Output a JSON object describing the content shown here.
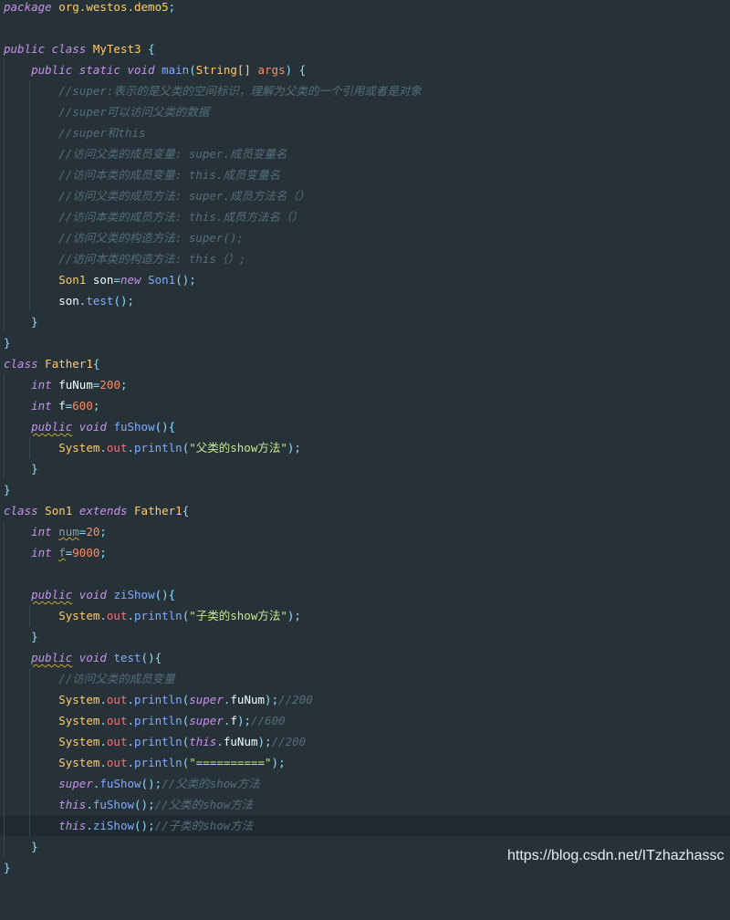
{
  "code": {
    "package_kw": "package",
    "package_name": "org.westos.demo5",
    "class_main": "MyTest3",
    "main_sig": {
      "mods": "public static void",
      "name": "main",
      "type": "String[]",
      "param": "args"
    },
    "comments_main": [
      "//super:表示的是父类的空间标识，理解为父类的一个引用或者是对象",
      "//super可以访问父类的数据",
      "//super和this",
      "//访问父类的成员变量: super.成员变量名",
      "//访问本类的成员变量: this.成员变量名",
      "//访问父类的成员方法: super.成员方法名（）",
      "//访问本类的成员方法: this.成员方法名（）",
      "//访问父类的构造方法: super();",
      "//访问本类的构造方法: this（）;"
    ],
    "class_father": "Father1",
    "father_fields": [
      {
        "name": "fuNum",
        "value": "200"
      },
      {
        "name": "f",
        "value": "600"
      }
    ],
    "father_method": "fuShow",
    "father_str": "\"父类的show方法\"",
    "class_son": "Son1",
    "son_fields": [
      {
        "name": "num",
        "value": "20"
      },
      {
        "name": "f",
        "value": "9000"
      }
    ],
    "son_method": "ziShow",
    "son_str": "\"子类的show方法\"",
    "test_method": "test",
    "test_comment": "//访问父类的成员变量",
    "test_results": [
      "//200",
      "//600",
      "//200"
    ],
    "separator_str": "\"==========\"",
    "call_comments": [
      "//父类的show方法",
      "//父类的show方法",
      "//子类的show方法"
    ]
  },
  "watermark": "https://blog.csdn.net/ITzhazhassc"
}
